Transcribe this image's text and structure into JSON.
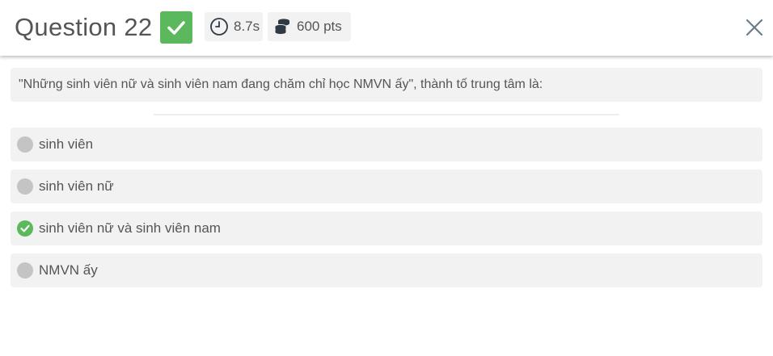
{
  "header": {
    "title": "Question 22",
    "status": "correct",
    "time_label": "8.7s",
    "points_label": "600 pts",
    "close_icon": "close-icon"
  },
  "question": {
    "text": "\"Những sinh viên nữ và sinh viên nam đang chăm chỉ học NMVN ấy\", thành tố trung tâm là:"
  },
  "options": [
    {
      "label": "sinh viên",
      "correct": false
    },
    {
      "label": "sinh viên nữ",
      "correct": false
    },
    {
      "label": "sinh viên nữ và sinh viên nam",
      "correct": true
    },
    {
      "label": "NMVN ấy",
      "correct": false
    }
  ],
  "colors": {
    "correct": "#5cb85c",
    "neutral_marker": "#c4c4c4",
    "panel": "#f2f2f2",
    "close": "#6a7d8c"
  }
}
